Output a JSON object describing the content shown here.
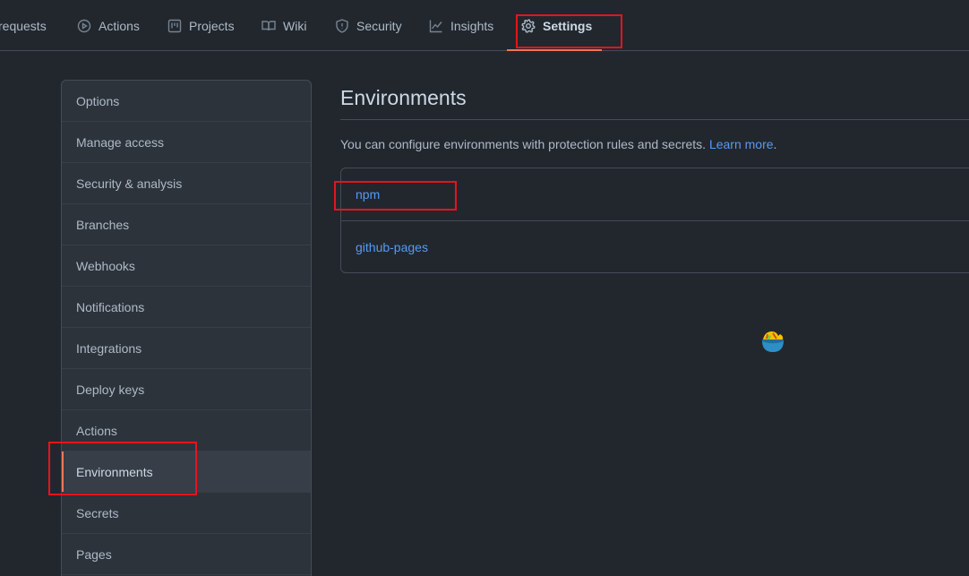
{
  "topnav": {
    "tabs": [
      {
        "label": "requests",
        "icon": "pull-request-icon"
      },
      {
        "label": "Actions",
        "icon": "play-icon"
      },
      {
        "label": "Projects",
        "icon": "project-icon"
      },
      {
        "label": "Wiki",
        "icon": "book-icon"
      },
      {
        "label": "Security",
        "icon": "shield-icon"
      },
      {
        "label": "Insights",
        "icon": "graph-icon"
      },
      {
        "label": "Settings",
        "icon": "gear-icon",
        "selected": true
      }
    ]
  },
  "sidebar": {
    "items": [
      {
        "label": "Options"
      },
      {
        "label": "Manage access"
      },
      {
        "label": "Security & analysis"
      },
      {
        "label": "Branches"
      },
      {
        "label": "Webhooks"
      },
      {
        "label": "Notifications"
      },
      {
        "label": "Integrations"
      },
      {
        "label": "Deploy keys"
      },
      {
        "label": "Actions"
      },
      {
        "label": "Environments",
        "active": true
      },
      {
        "label": "Secrets"
      },
      {
        "label": "Pages"
      }
    ]
  },
  "main": {
    "title": "Environments",
    "description": "You can configure environments with protection rules and secrets.",
    "learn_more": "Learn more",
    "period": ".",
    "environments": [
      "npm",
      "github-pages"
    ]
  },
  "colors": {
    "background": "#22272e",
    "link": "#539bf5",
    "accent": "#ec775c",
    "highlight": "#e5141c"
  }
}
